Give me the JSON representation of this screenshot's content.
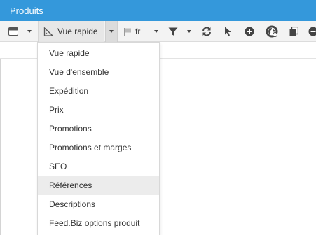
{
  "window": {
    "title": "Produits"
  },
  "toolbar": {
    "view_selector_label": "Vue rapide",
    "language_label": "fr"
  },
  "dropdown": {
    "items": [
      "Vue rapide",
      "Vue d'ensemble",
      "Expédition",
      "Prix",
      "Promotions",
      "Promotions et marges",
      "SEO",
      "Références",
      "Descriptions",
      "Feed.Biz options produit"
    ],
    "hovered_item": "Références"
  },
  "colors": {
    "title_bar": "#3498db",
    "toolbar_bg": "#f3f3f3",
    "menu_hover": "#ececec"
  },
  "icons": [
    "layout-icon",
    "caret-down-icon",
    "ruler-triangle-icon",
    "caret-down-icon",
    "flag-icon",
    "caret-down-icon",
    "filter-icon",
    "caret-down-icon",
    "refresh-icon",
    "cursor-icon",
    "add-circle-icon",
    "web-icon",
    "copy-icon",
    "remove-circle-icon"
  ]
}
